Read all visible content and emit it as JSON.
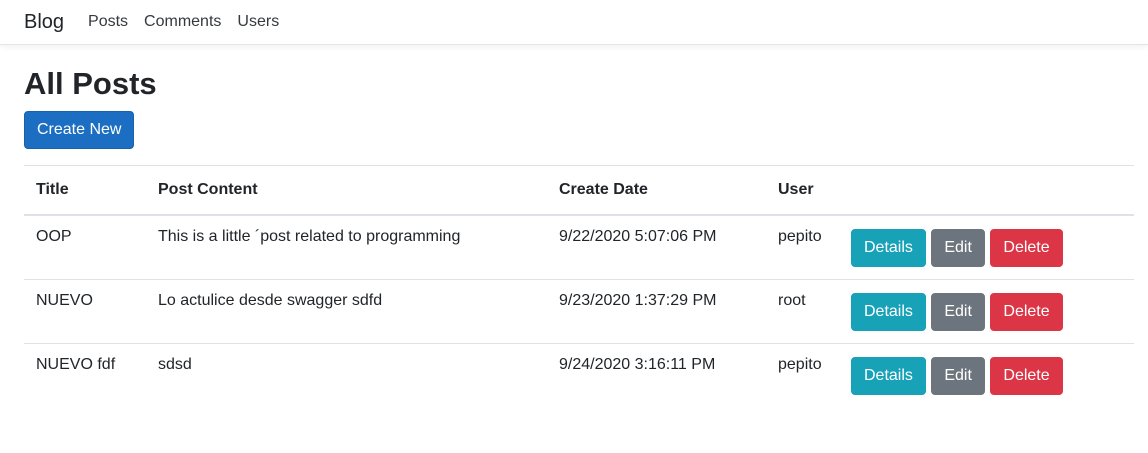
{
  "nav": {
    "brand": "Blog",
    "links": [
      "Posts",
      "Comments",
      "Users"
    ]
  },
  "page": {
    "title": "All Posts",
    "create_label": "Create New"
  },
  "table": {
    "headers": [
      "Title",
      "Post Content",
      "Create Date",
      "User"
    ],
    "rows": [
      {
        "title": "OOP",
        "content": "This is a little ´post related to programming",
        "date": "9/22/2020 5:07:06 PM",
        "user": "pepito"
      },
      {
        "title": "NUEVO",
        "content": "Lo actulice desde swagger sdfd",
        "date": "9/23/2020 1:37:29 PM",
        "user": "root"
      },
      {
        "title": "NUEVO fdf",
        "content": "sdsd",
        "date": "9/24/2020 3:16:11 PM",
        "user": "pepito"
      }
    ],
    "actions": {
      "details": "Details",
      "edit": "Edit",
      "delete": "Delete"
    }
  },
  "colors": {
    "primary": "#1b6ec2",
    "info": "#17a2b8",
    "secondary": "#6c757d",
    "danger": "#dc3545"
  }
}
